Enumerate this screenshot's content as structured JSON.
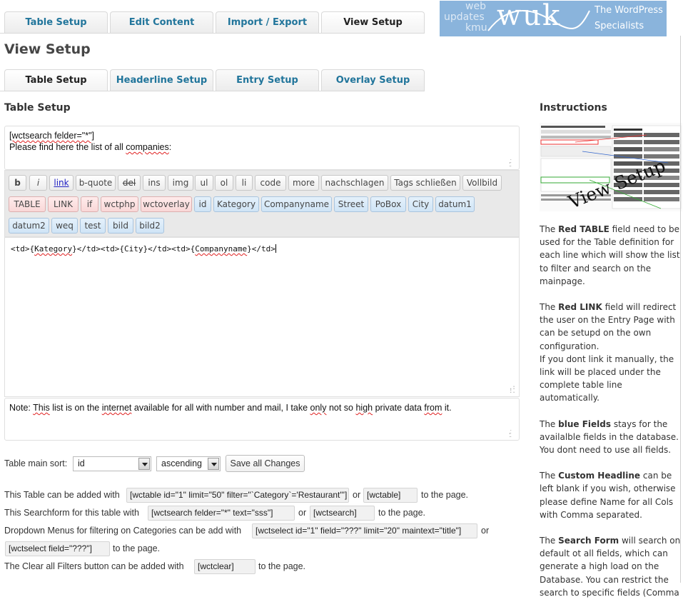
{
  "top_tabs": [
    "Table Setup",
    "Edit Content",
    "Import / Export",
    "View Setup"
  ],
  "logo": {
    "line1": "web",
    "line2": "updates",
    "line3": "kmu",
    "mark": "wuk",
    "claim1": "The WordPress",
    "claim2": "Specialists"
  },
  "page_title": "View Setup",
  "sub_tabs": [
    "Table Setup",
    "Headerline Setup",
    "Entry Setup",
    "Overlay Setup"
  ],
  "section_title": "Table Setup",
  "header_textarea": {
    "line1": "[wctsearch felder=\"*\"]",
    "line2_pre": "Please find here the list of all ",
    "line2_word": "companies",
    "line2_post": ":"
  },
  "toolbar": {
    "row1": [
      "b",
      "i",
      "link",
      "b-quote",
      "del",
      "ins",
      "img",
      "ul",
      "ol",
      "li",
      "code",
      "more",
      "nachschlagen",
      "Tags schließen",
      "Vollbild"
    ],
    "row2_red": [
      "TABLE",
      "LINK",
      "if",
      "wctphp",
      "wctoverlay"
    ],
    "row2_blue": [
      "id",
      "Kategory",
      "Companyname",
      "Street",
      "PoBox",
      "City",
      "datum1"
    ],
    "row3_blue": [
      "datum2",
      "weq",
      "test",
      "bild",
      "bild2"
    ]
  },
  "code": {
    "p1": "<td>{",
    "w1": "Kategory",
    "p2": "}</td><td>{City}</td><td>{",
    "w2": "Companyname",
    "p3": "}</td>"
  },
  "note": {
    "t1": "Note: ",
    "w1": "This",
    "t2": " list is on the ",
    "w2": "internet",
    "t3": " available for all with number and mail, I take ",
    "w3": "only",
    "t4": " not so ",
    "w4": "high",
    "t5": " private data ",
    "w5": "from",
    "t6": " it."
  },
  "sort": {
    "label": "Table main sort:",
    "field": "id",
    "order": "ascending",
    "save": "Save all Changes"
  },
  "shortcodes": {
    "table_pre": "This Table can be added with",
    "table_code": "[wctable id=\"1\" limit=\"50\" filter=\"`Category`='Restaurant'\"]",
    "or1": "or",
    "table_short": "[wctable]",
    "table_post": "to the page.",
    "search_pre": "This Searchform for this table with",
    "search_code": "[wctsearch felder=\"*\" text=\"sss\"]",
    "or2": "or",
    "search_short": "[wctsearch]",
    "search_post": "to the page.",
    "select_pre": "Dropdown Menus for filtering on Categories can be add with",
    "select_code": "[wctselect id=\"1\" field=\"???\" limit=\"20\" maintext=\"title\"]",
    "or3": "or",
    "select_short": "[wctselect field=\"???\"]",
    "select_post": "to the page.",
    "clear_pre": "The Clear all Filters button can be added with",
    "clear_code": "[wctclear]",
    "clear_post": "to the page."
  },
  "instructions": {
    "title": "Instructions",
    "thumb_text": "View Setup",
    "p1_pre": "The ",
    "p1_b": "Red TABLE",
    "p1_post": " field need to be used for the Table definition for each line which will show the list to filter and search on the mainpage.",
    "p2_pre": "The ",
    "p2_b": "Red LINK",
    "p2_post": " field will redirect the user on the Entry Page with can be setupd on the own configuration.",
    "p2_extra": "If you dont link it manually, the link will be placed under the complete table line automatically.",
    "p3_pre": "The ",
    "p3_b": "blue Fields",
    "p3_post": " stays for the availalble fields in the database. You dont need to use all fields.",
    "p4_pre": "The ",
    "p4_b": "Custom Headline",
    "p4_post": " can be left blank if you wish, otherwise please define Name for all Cols with Comma separated.",
    "p5_pre": "The ",
    "p5_b": "Search Form",
    "p5_post": " will search on default ot all fields, which can generate a high load on the Database. You can restrict the search to specific fields (Comma"
  },
  "colors": {
    "tab_text": "#21759b",
    "red_button": "#f9d7d7",
    "blue_button": "#cfe4f6",
    "logo_bg": "#8ab4dc"
  }
}
